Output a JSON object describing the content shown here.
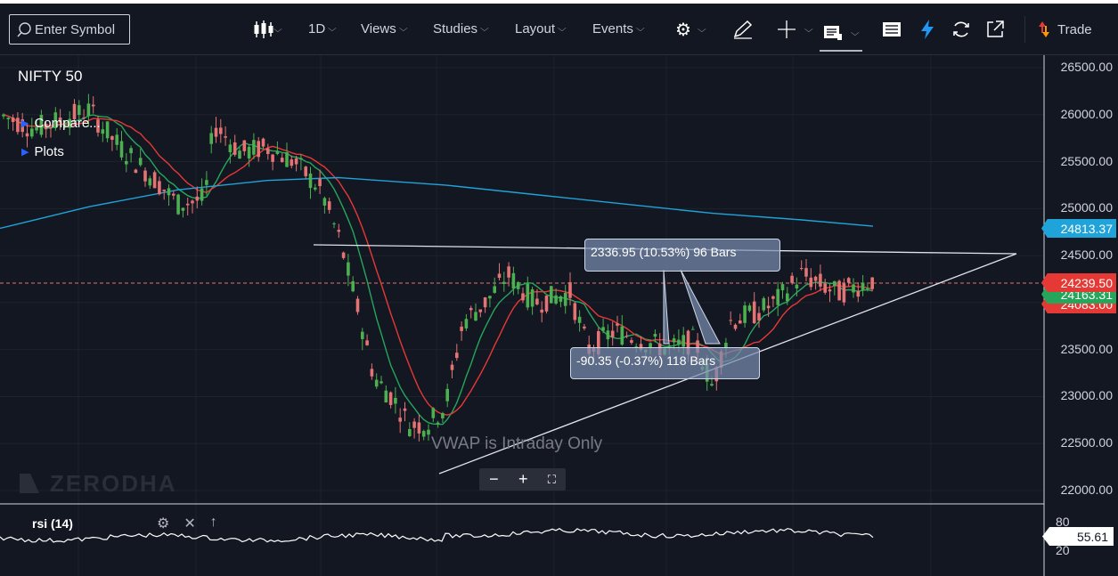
{
  "toolbar": {
    "search_placeholder": "Enter Symbol",
    "interval": "1D",
    "views": "Views",
    "studies": "Studies",
    "layout": "Layout",
    "events": "Events",
    "trade": "Trade",
    "icons": [
      "candles-icon",
      "gear-icon",
      "pencil-icon",
      "crosshair-icon",
      "book-icon",
      "list-icon",
      "flash-icon",
      "refresh-icon",
      "popout-icon",
      "trade-icon"
    ]
  },
  "chart": {
    "symbol": "NIFTY 50",
    "compare_label": "Compare...",
    "plots_label": "Plots",
    "watermark": "ZERODHA",
    "vwap_note": "VWAP is Intraday Only",
    "zoom_minus": "−",
    "zoom_plus": "+",
    "zoom_fit": "⛶",
    "y_ticks": [
      "26500.00",
      "26000.00",
      "25500.00",
      "25000.00",
      "24500.00",
      "24000.00",
      "23500.00",
      "23000.00",
      "22500.00",
      "22000.00"
    ],
    "y_tick_values": [
      26500,
      26000,
      25500,
      25000,
      24500,
      24000,
      23500,
      23000,
      22500,
      22000
    ],
    "price_labels": {
      "sma_long": "24813.37",
      "last": "24239.50",
      "hidden_1": "24163.31",
      "hidden_2": "24083.00"
    },
    "colors": {
      "background": "#131722",
      "up": "#4caf50",
      "down": "#e57373",
      "ema_fast": "#26a65b",
      "ema_slow": "#e53935",
      "sma_long": "#1fa3d8",
      "measure_box": "#7890b5"
    },
    "measurements": [
      {
        "text": "2336.95 (10.53%) 96 Bars"
      },
      {
        "text": "-90.35 (-0.37%) 118 Bars"
      }
    ]
  },
  "rsi": {
    "label": "rsi (14)",
    "value": "55.61",
    "ticks": [
      "80",
      "20"
    ],
    "tools": [
      "gear-icon",
      "close-icon",
      "arrow-up-icon"
    ]
  }
}
